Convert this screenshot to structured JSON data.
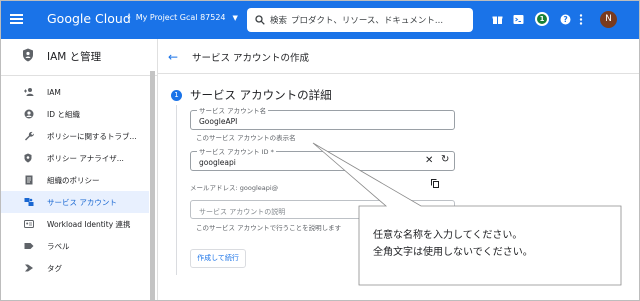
{
  "topbar": {
    "logo": "Google Cloud",
    "project": "My Project Gcal 87524",
    "search_label": "検索",
    "search_placeholder": "プロダクト、リソース、ドキュメント...",
    "notification_count": "1",
    "avatar_letter": "N",
    "colors": {
      "bar": "#1a73e8"
    }
  },
  "sidebar": {
    "title": "IAM と管理",
    "items": [
      {
        "label": "IAM",
        "icon": "person-add-icon"
      },
      {
        "label": "ID と組織",
        "icon": "account-circle-icon"
      },
      {
        "label": "ポリシーに関するトラブ...",
        "icon": "wrench-icon"
      },
      {
        "label": "ポリシー アナライザ...",
        "icon": "policy-search-icon"
      },
      {
        "label": "組織のポリシー",
        "icon": "document-icon"
      },
      {
        "label": "サービス アカウント",
        "icon": "service-account-icon",
        "active": true
      },
      {
        "label": "Workload Identity 連携",
        "icon": "id-card-icon"
      },
      {
        "label": "ラベル",
        "icon": "label-icon"
      },
      {
        "label": "タグ",
        "icon": "tag-icon"
      }
    ]
  },
  "main": {
    "page_title": "サービス アカウントの作成",
    "step_number": "1",
    "step_title": "サービス アカウントの詳細",
    "name_field": {
      "label": "サービス アカウント名",
      "value": "GoogleAPI",
      "hint": "このサービス アカウントの表示名"
    },
    "id_field": {
      "label": "サービス アカウント ID *",
      "value": "googleapi"
    },
    "email_label": "メールアドレス: googleapi@",
    "desc_field": {
      "placeholder": "サービス アカウントの説明",
      "hint": "このサービス アカウントで行うことを説明します"
    },
    "create_button": "作成して続行"
  },
  "callout": {
    "line1": "任意な名称を入力してください。",
    "line2": "全角文字は使用しないでください。"
  }
}
